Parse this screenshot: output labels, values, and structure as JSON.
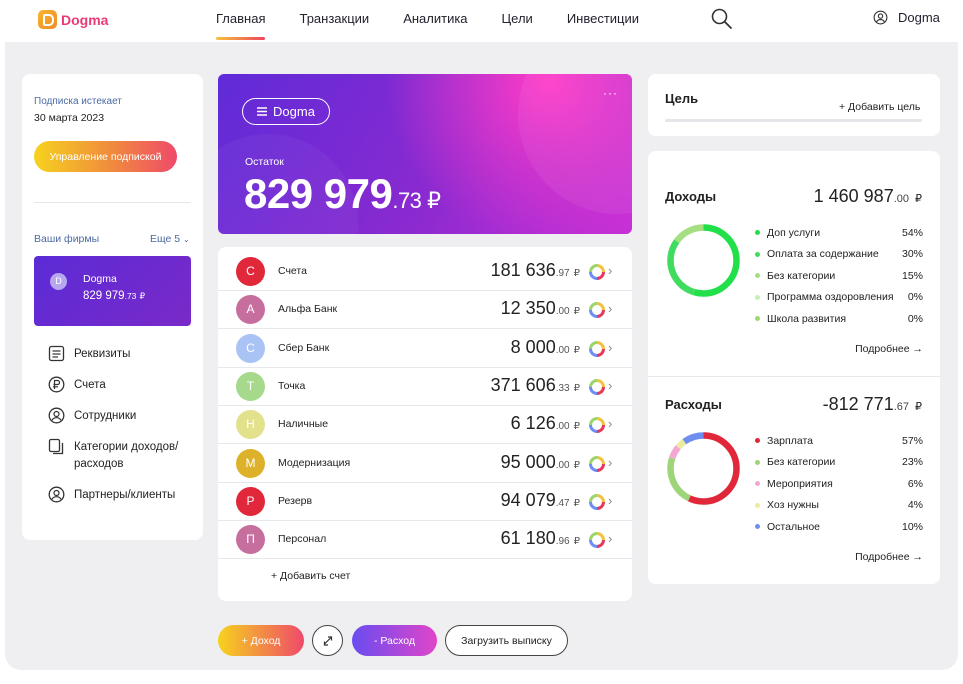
{
  "header": {
    "logo_text": "Dogma",
    "nav": [
      "Главная",
      "Транзакции",
      "Аналитика",
      "Цели",
      "Инвестиции"
    ],
    "user_name": "Dogma"
  },
  "subscription": {
    "label": "Подписка истекает",
    "date": "30 марта 2023",
    "manage_label": "Управление подпиской"
  },
  "firms": {
    "label": "Ваши фирмы",
    "more_label": "Еще 5",
    "current": {
      "initial": "D",
      "name": "Dogma",
      "amount_int": "829 979",
      "amount_dec": ".73",
      "currency": "₽"
    }
  },
  "side_menu": [
    "Реквизиты",
    "Счета",
    "Сотрудники",
    "Категории доходов/расходов",
    "Партнеры/клиенты"
  ],
  "balance": {
    "pill_label": "Dogma",
    "dots": "···",
    "label": "Остаток",
    "amount_int": "829 979",
    "amount_dec": ".73 ₽"
  },
  "accounts": [
    {
      "initial": "С",
      "name": "Счета",
      "int": "181 636",
      "dec": ".97",
      "currency": "₽",
      "color": "#e0283a"
    },
    {
      "initial": "А",
      "name": "Альфа Банк",
      "int": "12 350",
      "dec": ".00",
      "currency": "₽",
      "color": "#c66f9e"
    },
    {
      "initial": "С",
      "name": "Сбер Банк",
      "int": "8 000",
      "dec": ".00",
      "currency": "₽",
      "color": "#a9c3f5"
    },
    {
      "initial": "Т",
      "name": "Точка",
      "int": "371 606",
      "dec": ".33",
      "currency": "₽",
      "color": "#a6d98c"
    },
    {
      "initial": "Н",
      "name": "Наличные",
      "int": "6 126",
      "dec": ".00",
      "currency": "₽",
      "color": "#e3e28c"
    },
    {
      "initial": "М",
      "name": "Модернизация",
      "int": "95 000",
      "dec": ".00",
      "currency": "₽",
      "color": "#ddb22a"
    },
    {
      "initial": "Р",
      "name": "Резерв",
      "int": "94 079",
      "dec": ".47",
      "currency": "₽",
      "color": "#e0283a"
    },
    {
      "initial": "П",
      "name": "Персонал",
      "int": "61 180",
      "dec": ".96",
      "currency": "₽",
      "color": "#c66f9e"
    }
  ],
  "add_account_label": "+ Добавить счет",
  "actions": {
    "income": "+ Доход",
    "expense": "- Расход",
    "upload": "Загрузить выписку"
  },
  "goal": {
    "title": "Цель",
    "add_label": "+ Добавить цель"
  },
  "income": {
    "title": "Доходы",
    "total_int": "1 460 987",
    "total_dec": ".00",
    "currency": "₽",
    "items": [
      {
        "name": "Доп услуги",
        "pct": "54%",
        "value": 54,
        "color": "#22e04a"
      },
      {
        "name": "Оплата за содержание",
        "pct": "30%",
        "value": 30,
        "color": "#3fdc5f"
      },
      {
        "name": "Без категории",
        "pct": "15%",
        "value": 15,
        "color": "#a5df82"
      },
      {
        "name": "Программа оздоровления",
        "pct": "0%",
        "value": 0,
        "color": "#c6f0b4"
      },
      {
        "name": "Школа развития",
        "pct": "0%",
        "value": 0,
        "color": "#9dd96f"
      }
    ],
    "more_label": "Подробнее →"
  },
  "expenses": {
    "title": "Расходы",
    "total_int": "-812 771",
    "total_dec": ".67",
    "currency": "₽",
    "items": [
      {
        "name": "Зарплата",
        "pct": "57%",
        "value": 57,
        "color": "#e0283a"
      },
      {
        "name": "Без категории",
        "pct": "23%",
        "value": 23,
        "color": "#9ed47a"
      },
      {
        "name": "Мероприятия",
        "pct": "6%",
        "value": 6,
        "color": "#f3a8d4"
      },
      {
        "name": "Хоз нужны",
        "pct": "4%",
        "value": 4,
        "color": "#eceba0"
      },
      {
        "name": "Остальное",
        "pct": "10%",
        "value": 10,
        "color": "#6f8ff0"
      }
    ],
    "more_label": "Подробнее →"
  }
}
